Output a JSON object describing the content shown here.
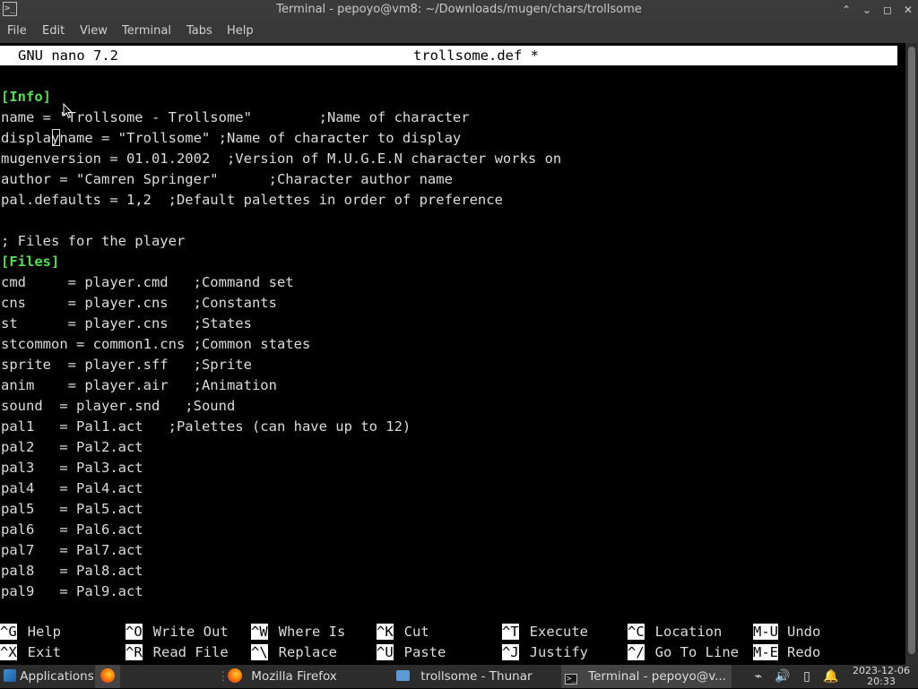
{
  "window": {
    "title": "Terminal - pepoyo@vm8: ~/Downloads/mugen/chars/trollsome",
    "buttons": {
      "minimize": "⌃",
      "restore": "⌄",
      "maximize": "◻",
      "close": "✕"
    }
  },
  "menu": [
    "File",
    "Edit",
    "View",
    "Terminal",
    "Tabs",
    "Help"
  ],
  "nano": {
    "version": "GNU nano 7.2",
    "filename": "trollsome.def *"
  },
  "file_lines": [
    "",
    "[Info]",
    "name = \"Trollsome - Trollsome\"        ;Name of character",
    "display",
    "mugenversion = 01.01.2002  ;Version of M.U.G.E.N character works on",
    "author = \"Camren Springer\"      ;Character author name",
    "pal.defaults = 1,2  ;Default palettes in order of preference",
    "",
    "; Files for the player",
    "[Files]",
    "cmd     = player.cmd   ;Command set",
    "cns     = player.cns   ;Constants",
    "st      = player.cns   ;States",
    "stcommon = common1.cns ;Common states",
    "sprite  = player.sff   ;Sprite",
    "anim    = player.air   ;Animation",
    "sound  = player.snd   ;Sound",
    "pal1   = Pal1.act   ;Palettes (can have up to 12)",
    "pal2   = Pal2.act",
    "pal3   = Pal3.act",
    "pal4   = Pal4.act",
    "pal5   = Pal5.act",
    "pal6   = Pal6.act",
    "pal7   = Pal7.act",
    "pal8   = Pal8.act",
    "pal9   = Pal9.act"
  ],
  "displayname_line": {
    "before_cursor": "display",
    "after_cursor": "name = \"Trollsome\" ;Name of character to display"
  },
  "shortcuts": [
    [
      {
        "key": "^G",
        "label": "Help"
      },
      {
        "key": "^O",
        "label": "Write Out"
      },
      {
        "key": "^W",
        "label": "Where Is"
      },
      {
        "key": "^K",
        "label": "Cut"
      },
      {
        "key": "^T",
        "label": "Execute"
      },
      {
        "key": "^C",
        "label": "Location"
      },
      {
        "key": "M-U",
        "label": "Undo"
      }
    ],
    [
      {
        "key": "^X",
        "label": "Exit"
      },
      {
        "key": "^R",
        "label": "Read File"
      },
      {
        "key": "^\\",
        "label": "Replace"
      },
      {
        "key": "^U",
        "label": "Paste"
      },
      {
        "key": "^J",
        "label": "Justify"
      },
      {
        "key": "^/",
        "label": "Go To Line"
      },
      {
        "key": "M-E",
        "label": "Redo"
      }
    ]
  ],
  "taskbar": {
    "applications_label": "Applications",
    "tasks": [
      {
        "icon": "firefox-icon",
        "label": "Mozilla Firefox"
      },
      {
        "icon": "folder-icon",
        "label": "trollsome - Thunar"
      },
      {
        "icon": "terminal-icon",
        "label": "Terminal - pepoyo@v..."
      }
    ],
    "clock": {
      "date": "2023-12-06",
      "time": "20:33"
    }
  },
  "colors": {
    "section_header": "#55dd55",
    "terminal_bg": "#000000",
    "nano_header_bg": "#ffffff"
  }
}
